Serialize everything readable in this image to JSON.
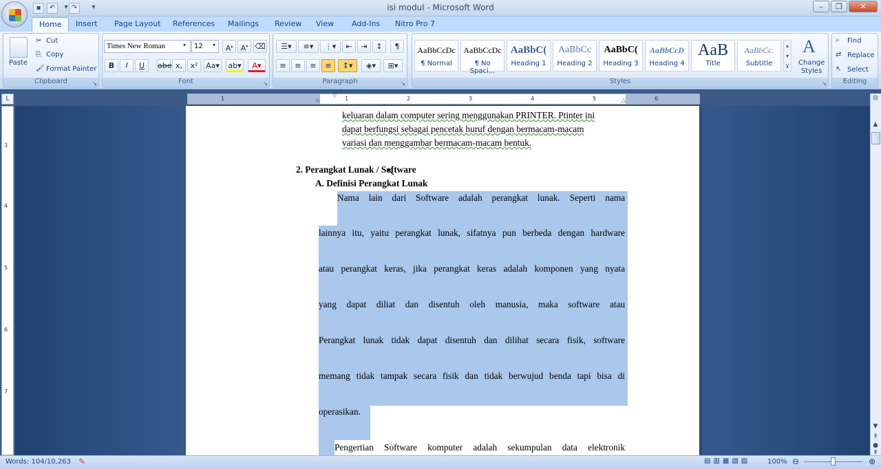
{
  "window": {
    "title": "isi modul - Microsoft Word"
  },
  "tabs": [
    "Home",
    "Insert",
    "Page Layout",
    "References",
    "Mailings",
    "Review",
    "View",
    "Add-Ins",
    "Nitro Pro 7"
  ],
  "active_tab": "Home",
  "clipboard": {
    "paste": "Paste",
    "cut": "Cut",
    "copy": "Copy",
    "format_painter": "Format Painter",
    "label": "Clipboard"
  },
  "font": {
    "name": "Times New Roman",
    "size": "12",
    "label": "Font"
  },
  "paragraph": {
    "label": "Paragraph"
  },
  "styles": {
    "label": "Styles",
    "items": [
      {
        "sample": "AaBbCcDc",
        "name": "¶ Normal"
      },
      {
        "sample": "AaBbCcDc",
        "name": "¶ No Spaci..."
      },
      {
        "sample": "AaBbC(",
        "name": "Heading 1"
      },
      {
        "sample": "AaBbCc",
        "name": "Heading 2"
      },
      {
        "sample": "AaBbC(",
        "name": "Heading 3"
      },
      {
        "sample": "AaBbCcD",
        "name": "Heading 4"
      },
      {
        "sample": "AaB",
        "name": "Title"
      },
      {
        "sample": "AaBbCc.",
        "name": "Subtitle"
      }
    ],
    "change_styles": "Change Styles"
  },
  "editing": {
    "find": "Find",
    "replace": "Replace",
    "select": "Select",
    "label": "Editing"
  },
  "document": {
    "lines_top": [
      "keluaran dalam computer sering menggunakan PRINTER. Ptinter ini",
      "dapat berfungsi sebagai pencetak huruf dengan bermacam-macam",
      "variasi dan menggambar bermacam-macam  bentuk."
    ],
    "heading_2": "2.   Perangkat Lunak / Software",
    "heading_a": "A.  Definisi Perangkat Lunak",
    "para1": [
      "Nama lain dari Software adalah perangkat lunak. Seperti nama",
      "lainnya itu, yaitu perangkat lunak, sifatnya pun berbeda dengan hardware",
      "atau perangkat keras, jika perangkat keras adalah komponen yang nyata",
      "yang dapat diliat dan disentuh oleh manusia, maka software atau",
      "Perangkat lunak tidak dapat disentuh dan dilihat secara fisik, software",
      "memang tidak tampak secara fisik dan tidak berwujud benda tapi bisa di",
      "operasikan."
    ],
    "para2_first": "Pengertian Software komputer adalah sekumpulan data elektronik"
  },
  "status": {
    "words": "Words: 104/10,263",
    "zoom": "100%"
  },
  "ruler_numbers": [
    "1",
    "1",
    "2",
    "3",
    "4",
    "5",
    "6"
  ],
  "vruler_numbers": [
    "3",
    "4",
    "5",
    "6",
    "7"
  ],
  "colors": {
    "ribbon_tab": "#bfdbff",
    "selection": "#aac8ec",
    "workspace": "#3b5b86"
  }
}
